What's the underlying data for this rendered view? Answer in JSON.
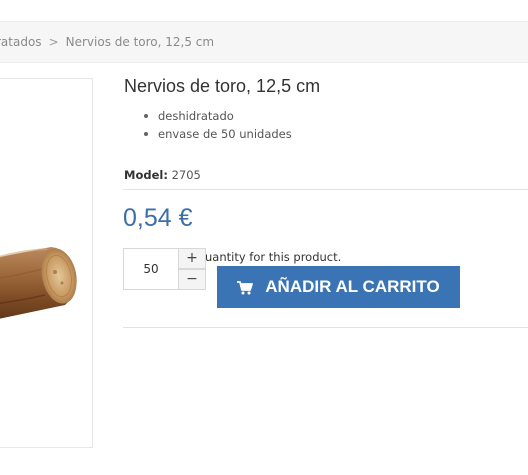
{
  "breadcrumb": {
    "items": [
      "ratados",
      "Nervios de toro, 12,5 cm"
    ],
    "separator": ">"
  },
  "product": {
    "title": "Nervios de toro, 12,5 cm",
    "features": [
      "deshidratado",
      "envase de 50 unidades"
    ],
    "model_label": "Model:",
    "model_value": "2705",
    "price": "0,54 €",
    "image_icon": "product-photo-bull-pizzle"
  },
  "purchase": {
    "quantity": "50",
    "increment_symbol": "+",
    "decrement_symbol": "−",
    "quantity_help": "uantity for this product.",
    "cart_label": "AÑADIR AL CARRITO",
    "cart_icon": "cart-icon"
  },
  "colors": {
    "price": "#3c6fa8",
    "cart_button": "#3b74b5",
    "breadcrumb_bg": "#f6f6f6"
  }
}
